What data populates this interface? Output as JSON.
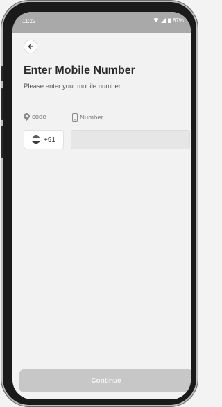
{
  "status_bar": {
    "time": "11:22",
    "battery": "87%"
  },
  "header": {
    "title": "Enter Mobile Number",
    "subtitle": "Please enter your mobile number"
  },
  "form": {
    "code_label": "code",
    "number_label": "Number",
    "country_code": "+91",
    "number_value": "",
    "number_placeholder": ""
  },
  "actions": {
    "continue_label": "Continue"
  },
  "colors": {
    "status_bar": "#a9a9a9",
    "button_disabled": "#c7c7c7"
  },
  "icons": [
    "back-arrow-icon",
    "location-pin-icon",
    "phone-icon",
    "flag-icon",
    "wifi-icon",
    "signal-icon",
    "battery-icon"
  ]
}
